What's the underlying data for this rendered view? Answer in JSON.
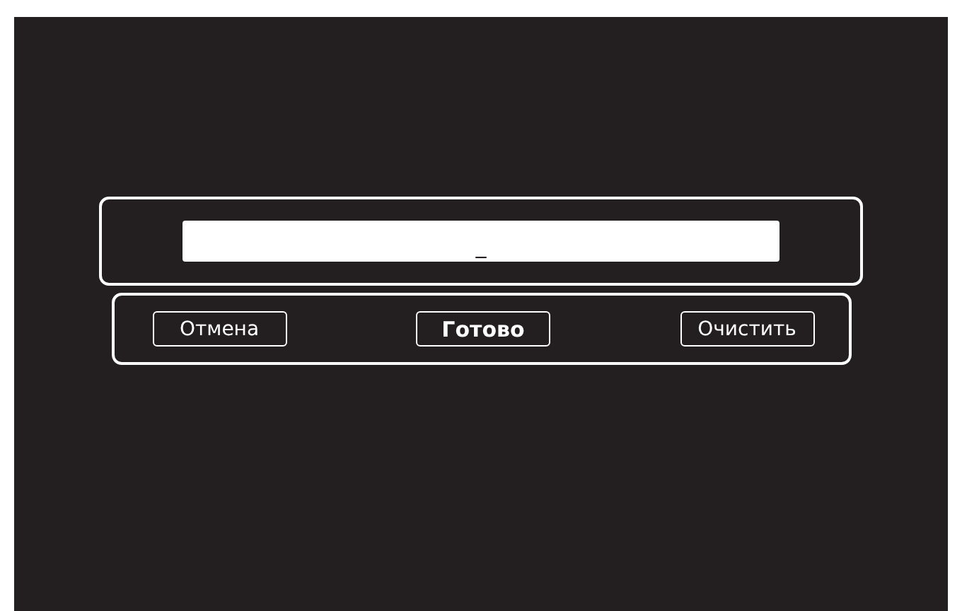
{
  "input": {
    "value": "_"
  },
  "buttons": [
    {
      "label": "Отмена",
      "selected": false
    },
    {
      "label": "Готово",
      "selected": true
    },
    {
      "label": "Очистить",
      "selected": false
    }
  ]
}
